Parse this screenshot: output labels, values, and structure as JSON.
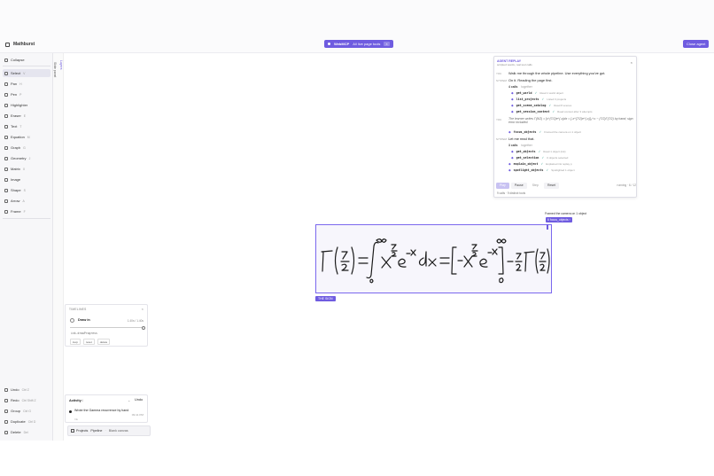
{
  "app": {
    "name": "Mathburst"
  },
  "mcp": {
    "label": "WebMCP",
    "tools": "All live page tools",
    "close": "×"
  },
  "header": {
    "close_agent": "Close agent"
  },
  "sidebar": {
    "items": [
      {
        "label": "Collapse",
        "kbd": ""
      },
      {
        "label": "Select",
        "kbd": "V"
      },
      {
        "label": "Pan",
        "kbd": "H"
      },
      {
        "label": "Pen",
        "kbd": "P"
      },
      {
        "label": "Highlighter",
        "kbd": ""
      },
      {
        "label": "Eraser",
        "kbd": "E"
      },
      {
        "label": "Text",
        "kbd": "T"
      },
      {
        "label": "Equation",
        "kbd": "M"
      },
      {
        "label": "Graph",
        "kbd": "G"
      },
      {
        "label": "Geometry",
        "kbd": "J"
      },
      {
        "label": "Matrix",
        "kbd": "X"
      },
      {
        "label": "Image",
        "kbd": ""
      },
      {
        "label": "Shape",
        "kbd": "S"
      },
      {
        "label": "Arrow",
        "kbd": "A"
      },
      {
        "label": "Frame",
        "kbd": "F"
      }
    ],
    "bottom": [
      {
        "label": "Undo",
        "kbd": "Ctrl Z"
      },
      {
        "label": "Redo",
        "kbd": "Ctrl Shift Z"
      },
      {
        "label": "Group",
        "kbd": "Ctrl G"
      },
      {
        "label": "Duplicate",
        "kbd": "Ctrl D"
      },
      {
        "label": "Delete",
        "kbd": "Del"
      }
    ]
  },
  "rail": {
    "text1": "Slide panel",
    "text2": "Layers"
  },
  "agent": {
    "title": "AGENT REPLAY",
    "subtitle": "scripted words, real tool calls",
    "close": "×",
    "you_label": "YOU",
    "system_label": "SYSTEM",
    "msg1": "Walk me through the whole pipeline. Use everything you've got.",
    "msg2": "On it. Reading the page first.",
    "calls1_head": "4 calls",
    "calls1_tag": "together",
    "calls1": [
      {
        "fn": "get_world",
        "res": "Read 1 world object"
      },
      {
        "fn": "list_projects",
        "res": "Listed 3 projects"
      },
      {
        "fn": "get_scene_catalog",
        "res": "Read 8 scenes"
      },
      {
        "fn": "get_session_context",
        "res": "Read context after 3 attempts"
      }
    ],
    "msg3": "The learner writes Γ(9/2) = ∫x^{7/2}e^{-x}dx = [-x^{7/2}e^{-x}]₀^∞ − (7/2)Γ(7/2) by hand; sign error included.",
    "call_single": {
      "fn": "focus_objects",
      "res": "Framed the camera on 1 object"
    },
    "msg4": "Let me read that.",
    "calls2_head": "3 calls",
    "calls2_tag": "together",
    "calls2": [
      {
        "fn": "get_objects",
        "res": "Read 1 object (ink)"
      },
      {
        "fn": "get_selection",
        "res": "0 objects selected"
      },
      {
        "fn": "explain_object",
        "res": "Explained ink replay p"
      },
      {
        "fn": "spotlight_objects",
        "res": "Spotlighted 1 object"
      }
    ],
    "controls": {
      "play": "Play",
      "pause": "Pause",
      "step": "Step",
      "reset": "Reset"
    },
    "status": "running · 6 / 12",
    "footer": "9 calls · 9 distinct tools"
  },
  "canvas": {
    "focus_tip": "Framed the camera on 1 object",
    "focus_badge": "6 focus_objects ›",
    "frame_label": "THE SIGN"
  },
  "timelines": {
    "title": "TIMELINES",
    "close": "×",
    "item": "Draw in",
    "time": "1.40s / 1.40s",
    "prop": "ink.drawProgress",
    "actions": [
      "loop",
      "reset",
      "delete"
    ]
  },
  "activity": {
    "title": "Activity",
    "count": "4",
    "undo": "Undo",
    "item": "Wrote the Gamma recurrence by hand",
    "time": "09:41 PM",
    "sub": "Ink"
  },
  "bottom_nav": {
    "projects": "Projects",
    "pipeline": "Pipeline",
    "canvas": "Blank canvas"
  },
  "colors": {
    "accent": "#6f5ce0"
  }
}
